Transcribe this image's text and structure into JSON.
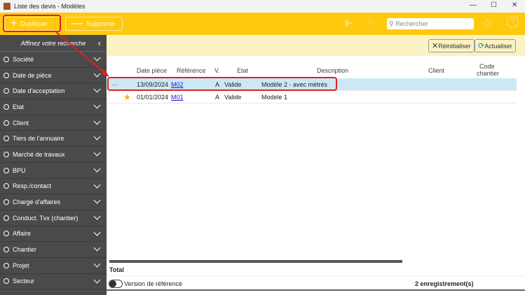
{
  "window": {
    "title": "Liste des devis - Modèles"
  },
  "toolbar": {
    "duplicate": "Dupliquer",
    "delete": "Supprimer",
    "search_placeholder": "Rechercher"
  },
  "sidebar": {
    "title": "Affinez votre recherche",
    "items": [
      "Société",
      "Date de pièce",
      "Date d'acceptation",
      "Etat",
      "Client",
      "Tiers de l'annuaire",
      "Marché de travaux",
      "BPU",
      "Resp./contact",
      "Chargé d'affaires",
      "Conduct. Tvx (chantier)",
      "Affaire",
      "Chantier",
      "Projet",
      "Secteur"
    ]
  },
  "filters": {
    "reset": "Réinitialiser",
    "refresh": "Actualiser"
  },
  "table": {
    "columns": {
      "date": "Date pièce",
      "ref": "Référence",
      "v": "V.",
      "etat": "Etat",
      "desc": "Description",
      "client": "Client",
      "code1": "Code",
      "code2": "chantier"
    },
    "rows": [
      {
        "menu": "···",
        "date": "13/09/2024",
        "ref": "M02",
        "v": "A",
        "etat": "Valide",
        "desc": "Modèle 2 - avec métrés"
      },
      {
        "date": "01/01/2024",
        "ref": "M01",
        "v": "A",
        "etat": "Valide",
        "desc": "Modele 1"
      }
    ]
  },
  "footer": {
    "total": "Total",
    "toggle": "Version de référence",
    "count": "2 enregistrement(s)"
  }
}
